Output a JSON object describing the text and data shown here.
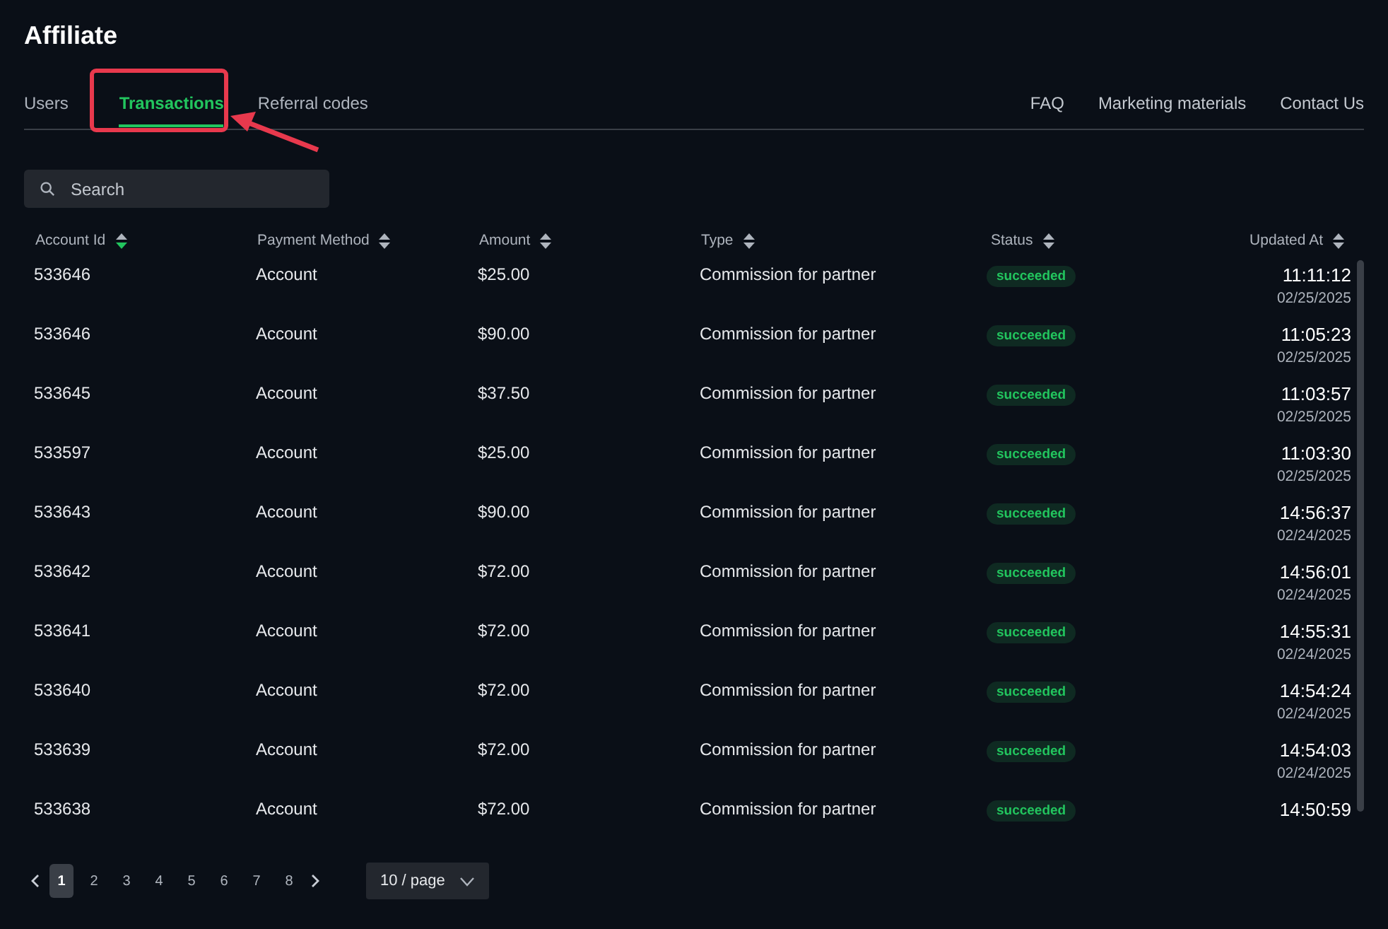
{
  "title": "Affiliate",
  "tabs": [
    {
      "label": "Users",
      "selected": false
    },
    {
      "label": "Transactions",
      "selected": true
    },
    {
      "label": "Referral codes",
      "selected": false
    }
  ],
  "links": [
    "FAQ",
    "Marketing materials",
    "Contact Us"
  ],
  "search": {
    "placeholder": "Search"
  },
  "table": {
    "columns": [
      {
        "label": "Account Id",
        "sorted_descending": true
      },
      {
        "label": "Payment Method",
        "sorted_descending": false
      },
      {
        "label": "Amount",
        "sorted_descending": false
      },
      {
        "label": "Type",
        "sorted_descending": false
      },
      {
        "label": "Status",
        "sorted_descending": false
      },
      {
        "label": "Updated At",
        "sorted_descending": false
      }
    ],
    "rows": [
      {
        "account_id": "533646",
        "payment_method": "Account",
        "amount": "$25.00",
        "type": "Commission for partner",
        "status": "succeeded",
        "time": "11:11:12",
        "date": "02/25/2025"
      },
      {
        "account_id": "533646",
        "payment_method": "Account",
        "amount": "$90.00",
        "type": "Commission for partner",
        "status": "succeeded",
        "time": "11:05:23",
        "date": "02/25/2025"
      },
      {
        "account_id": "533645",
        "payment_method": "Account",
        "amount": "$37.50",
        "type": "Commission for partner",
        "status": "succeeded",
        "time": "11:03:57",
        "date": "02/25/2025"
      },
      {
        "account_id": "533597",
        "payment_method": "Account",
        "amount": "$25.00",
        "type": "Commission for partner",
        "status": "succeeded",
        "time": "11:03:30",
        "date": "02/25/2025"
      },
      {
        "account_id": "533643",
        "payment_method": "Account",
        "amount": "$90.00",
        "type": "Commission for partner",
        "status": "succeeded",
        "time": "14:56:37",
        "date": "02/24/2025"
      },
      {
        "account_id": "533642",
        "payment_method": "Account",
        "amount": "$72.00",
        "type": "Commission for partner",
        "status": "succeeded",
        "time": "14:56:01",
        "date": "02/24/2025"
      },
      {
        "account_id": "533641",
        "payment_method": "Account",
        "amount": "$72.00",
        "type": "Commission for partner",
        "status": "succeeded",
        "time": "14:55:31",
        "date": "02/24/2025"
      },
      {
        "account_id": "533640",
        "payment_method": "Account",
        "amount": "$72.00",
        "type": "Commission for partner",
        "status": "succeeded",
        "time": "14:54:24",
        "date": "02/24/2025"
      },
      {
        "account_id": "533639",
        "payment_method": "Account",
        "amount": "$72.00",
        "type": "Commission for partner",
        "status": "succeeded",
        "time": "14:54:03",
        "date": "02/24/2025"
      },
      {
        "account_id": "533638",
        "payment_method": "Account",
        "amount": "$72.00",
        "type": "Commission for partner",
        "status": "succeeded",
        "time": "14:50:59"
      }
    ]
  },
  "pagination": {
    "pages": [
      {
        "label": "1",
        "selected": true
      },
      {
        "label": "2",
        "selected": false
      },
      {
        "label": "3",
        "selected": false
      },
      {
        "label": "4",
        "selected": false
      },
      {
        "label": "5",
        "selected": false
      },
      {
        "label": "6",
        "selected": false
      },
      {
        "label": "7",
        "selected": false
      },
      {
        "label": "8",
        "selected": false
      }
    ],
    "page_size": "10 / page"
  }
}
